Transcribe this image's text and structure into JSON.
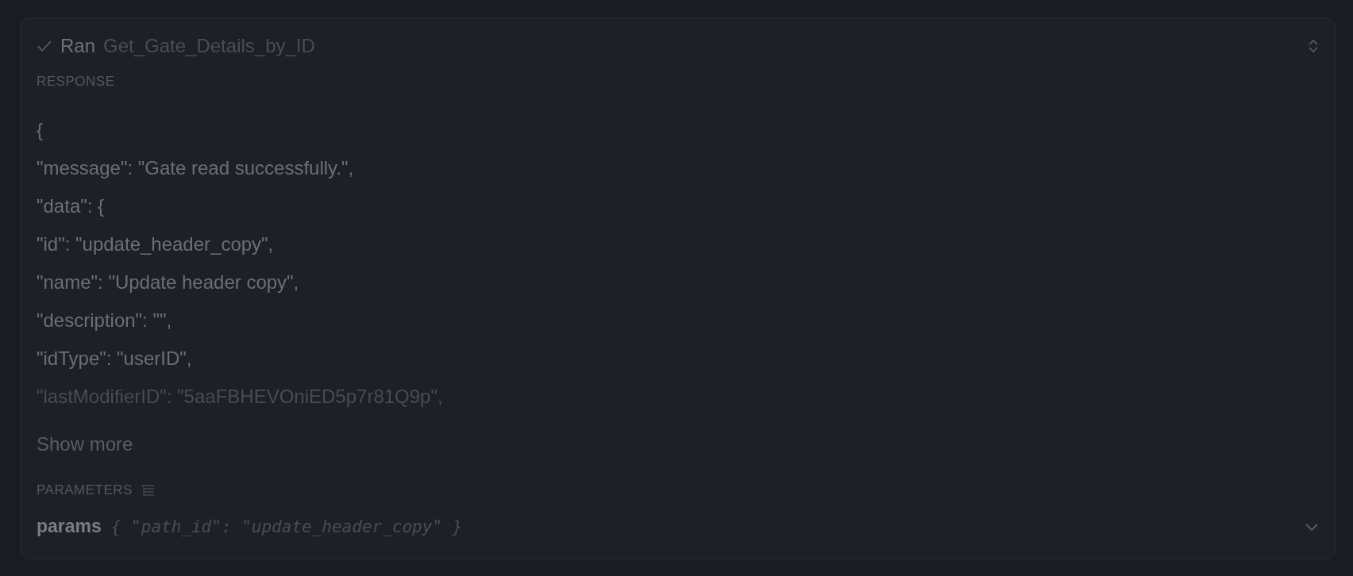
{
  "header": {
    "status": "Ran",
    "tool_name": "Get_Gate_Details_by_ID",
    "done": true
  },
  "response": {
    "label": "RESPONSE",
    "lines": [
      "{",
      "\"message\": \"Gate read successfully.\",",
      "\"data\": {",
      "\"id\": \"update_header_copy\",",
      "\"name\": \"Update header copy\",",
      "\"description\": \"\",",
      "\"idType\": \"userID\",",
      "\"lastModifierID\": \"5aaFBHEVOniED5p7r81Q9p\","
    ],
    "show_more": "Show more"
  },
  "parameters": {
    "label": "PARAMETERS",
    "name": "params",
    "value": "{ \"path_id\": \"update_header_copy\" }",
    "expanded": false
  }
}
